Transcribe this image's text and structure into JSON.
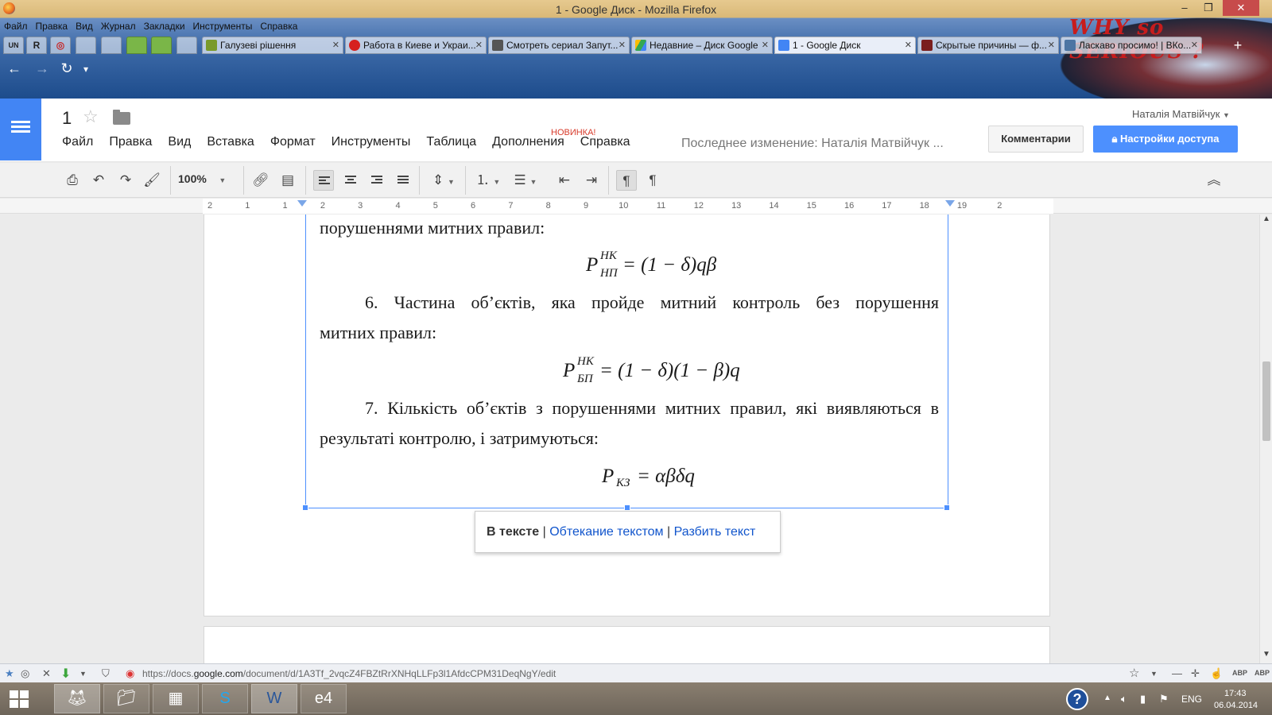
{
  "window": {
    "title": "1 - Google Диск - Mozilla Firefox"
  },
  "firefox_menu": [
    "Файл",
    "Правка",
    "Вид",
    "Журнал",
    "Закладки",
    "Инструменты",
    "Справка"
  ],
  "pinned_tabs": [
    "UN",
    "R",
    "◎",
    "",
    "",
    "",
    "",
    ""
  ],
  "tabs": [
    {
      "label": "Галузеві рішення",
      "color": "#7a9a2a"
    },
    {
      "label": "Работа в Киеве и Украи...",
      "color": "#d6201f"
    },
    {
      "label": "Смотреть сериал Запут...",
      "color": "#555555"
    },
    {
      "label": "Недавние – Диск Google",
      "color": "#34a853"
    },
    {
      "label": "1 - Google Диск",
      "color": "#4285f4"
    },
    {
      "label": "Скрытые причины — ф...",
      "color": "#7a1e1e"
    },
    {
      "label": "Ласкаво просимо! | ВКо...",
      "color": "#4c75a3"
    }
  ],
  "browser_art": {
    "text": "WHY so SERIOUS ?"
  },
  "docs": {
    "title": "1",
    "menus": [
      "Файл",
      "Правка",
      "Вид",
      "Вставка",
      "Формат",
      "Инструменты",
      "Таблица",
      "Дополнения",
      "Справка"
    ],
    "new_badge": "НОВИНКА!",
    "last_edit": "Последнее изменение: Наталія Матвійчук ...",
    "user": "Наталія Матвійчук",
    "comments_label": "Комментарии",
    "share_label": "Настройки доступа"
  },
  "toolbar": {
    "zoom": "100%"
  },
  "ruler": {
    "numbers": [
      "2",
      "1",
      "1",
      "2",
      "3",
      "4",
      "5",
      "6",
      "7",
      "8",
      "9",
      "10",
      "11",
      "12",
      "13",
      "14",
      "15",
      "16",
      "17",
      "18",
      "19",
      "2"
    ]
  },
  "document": {
    "line1": "порушеннями митних правил:",
    "formula1": {
      "main": "P",
      "sup": "НК",
      "sub": "НП",
      "rhs": "= (1 − δ)qβ"
    },
    "p6_line1": "6. Частина об’єктів, яка пройде митний контроль без порушення",
    "p6_line2": "митних правил:",
    "formula2": {
      "main": "P",
      "sup": "НК",
      "sub": "БП",
      "rhs": "= (1 − δ)(1 − β)q"
    },
    "p7_line1": "7. Кількість об’єктів з порушеннями митних правил, які виявляються в",
    "p7_line2": "результаті контролю, і затримуються:",
    "formula3": {
      "main": "P",
      "sub": "КЗ",
      "rhs": "= αβδq"
    }
  },
  "wrap_popup": {
    "inline": "В тексте",
    "wrap": "Обтекание текстом",
    "break": "Разбить текст",
    "sep": "|"
  },
  "url": {
    "prefix": "https://docs.",
    "domain": "google.com",
    "path": "/document/d/1A3Tf_2vqcZ4FBZtRrXNHqLLFp3l1AfdcCPM31DeqNgY/edit"
  },
  "tray": {
    "lang": "ENG",
    "time": "17:43",
    "date": "06.04.2014"
  }
}
